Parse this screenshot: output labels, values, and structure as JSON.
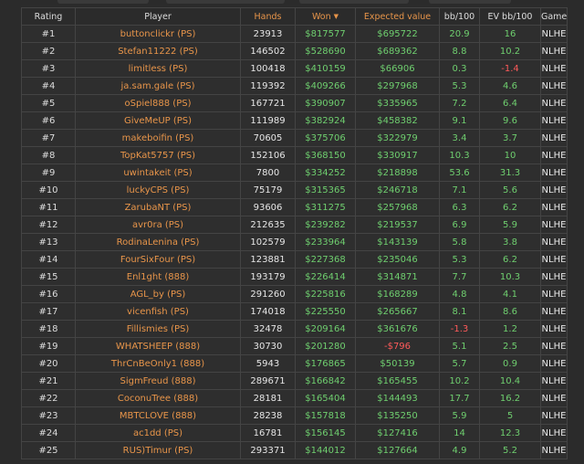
{
  "columns": [
    {
      "key": "rating",
      "label": "Rating"
    },
    {
      "key": "player",
      "label": "Player"
    },
    {
      "key": "hands",
      "label": "Hands"
    },
    {
      "key": "won",
      "label": "Won"
    },
    {
      "key": "ev",
      "label": "Expected value"
    },
    {
      "key": "bb100",
      "label": "bb/100"
    },
    {
      "key": "evbb100",
      "label": "EV bb/100"
    },
    {
      "key": "game",
      "label": "Game"
    }
  ],
  "sort_indicator": "▼",
  "colors": {
    "player": "#e8954a",
    "positive": "#6fcf6f",
    "negative": "#ff5a5a"
  },
  "rows": [
    {
      "rating": "#1",
      "player": "buttonclickr (PS)",
      "hands": "23913",
      "won": "$817577",
      "ev": "$695722",
      "bb100": "20.9",
      "evbb100": "16",
      "game": "NLHE"
    },
    {
      "rating": "#2",
      "player": "Stefan11222 (PS)",
      "hands": "146502",
      "won": "$528690",
      "ev": "$689362",
      "bb100": "8.8",
      "evbb100": "10.2",
      "game": "NLHE"
    },
    {
      "rating": "#3",
      "player": "limitless (PS)",
      "hands": "100418",
      "won": "$410159",
      "ev": "$66906",
      "bb100": "0.3",
      "evbb100": "-1.4",
      "game": "NLHE"
    },
    {
      "rating": "#4",
      "player": "ja.sam.gale (PS)",
      "hands": "119392",
      "won": "$409266",
      "ev": "$297968",
      "bb100": "5.3",
      "evbb100": "4.6",
      "game": "NLHE"
    },
    {
      "rating": "#5",
      "player": "oSpiel888 (PS)",
      "hands": "167721",
      "won": "$390907",
      "ev": "$335965",
      "bb100": "7.2",
      "evbb100": "6.4",
      "game": "NLHE"
    },
    {
      "rating": "#6",
      "player": "GiveMeUP (PS)",
      "hands": "111989",
      "won": "$382924",
      "ev": "$458382",
      "bb100": "9.1",
      "evbb100": "9.6",
      "game": "NLHE"
    },
    {
      "rating": "#7",
      "player": "makeboifin (PS)",
      "hands": "70605",
      "won": "$375706",
      "ev": "$322979",
      "bb100": "3.4",
      "evbb100": "3.7",
      "game": "NLHE"
    },
    {
      "rating": "#8",
      "player": "TopKat5757 (PS)",
      "hands": "152106",
      "won": "$368150",
      "ev": "$330917",
      "bb100": "10.3",
      "evbb100": "10",
      "game": "NLHE"
    },
    {
      "rating": "#9",
      "player": "uwintakeit (PS)",
      "hands": "7800",
      "won": "$334252",
      "ev": "$218898",
      "bb100": "53.6",
      "evbb100": "31.3",
      "game": "NLHE"
    },
    {
      "rating": "#10",
      "player": "luckyCPS (PS)",
      "hands": "75179",
      "won": "$315365",
      "ev": "$246718",
      "bb100": "7.1",
      "evbb100": "5.6",
      "game": "NLHE"
    },
    {
      "rating": "#11",
      "player": "ZarubaNT (PS)",
      "hands": "93606",
      "won": "$311275",
      "ev": "$257968",
      "bb100": "6.3",
      "evbb100": "6.2",
      "game": "NLHE"
    },
    {
      "rating": "#12",
      "player": "avr0ra (PS)",
      "hands": "212635",
      "won": "$239282",
      "ev": "$219537",
      "bb100": "6.9",
      "evbb100": "5.9",
      "game": "NLHE"
    },
    {
      "rating": "#13",
      "player": "RodinaLenina (PS)",
      "hands": "102579",
      "won": "$233964",
      "ev": "$143139",
      "bb100": "5.8",
      "evbb100": "3.8",
      "game": "NLHE"
    },
    {
      "rating": "#14",
      "player": "FourSixFour (PS)",
      "hands": "123881",
      "won": "$227368",
      "ev": "$235046",
      "bb100": "5.3",
      "evbb100": "6.2",
      "game": "NLHE"
    },
    {
      "rating": "#15",
      "player": "Enl1ght (888)",
      "hands": "193179",
      "won": "$226414",
      "ev": "$314871",
      "bb100": "7.7",
      "evbb100": "10.3",
      "game": "NLHE"
    },
    {
      "rating": "#16",
      "player": "AGL_by (PS)",
      "hands": "291260",
      "won": "$225816",
      "ev": "$168289",
      "bb100": "4.8",
      "evbb100": "4.1",
      "game": "NLHE"
    },
    {
      "rating": "#17",
      "player": "vicenfish (PS)",
      "hands": "174018",
      "won": "$225550",
      "ev": "$265667",
      "bb100": "8.1",
      "evbb100": "8.6",
      "game": "NLHE"
    },
    {
      "rating": "#18",
      "player": "Fillismies (PS)",
      "hands": "32478",
      "won": "$209164",
      "ev": "$361676",
      "bb100": "-1.3",
      "evbb100": "1.2",
      "game": "NLHE"
    },
    {
      "rating": "#19",
      "player": "WHATSHEEP (888)",
      "hands": "30730",
      "won": "$201280",
      "ev": "-$796",
      "bb100": "5.1",
      "evbb100": "2.5",
      "game": "NLHE"
    },
    {
      "rating": "#20",
      "player": "ThrCnBeOnly1 (888)",
      "hands": "5943",
      "won": "$176865",
      "ev": "$50139",
      "bb100": "5.7",
      "evbb100": "0.9",
      "game": "NLHE"
    },
    {
      "rating": "#21",
      "player": "SigmFreud (888)",
      "hands": "289671",
      "won": "$166842",
      "ev": "$165455",
      "bb100": "10.2",
      "evbb100": "10.4",
      "game": "NLHE"
    },
    {
      "rating": "#22",
      "player": "CoconuTree (888)",
      "hands": "28181",
      "won": "$165404",
      "ev": "$144493",
      "bb100": "17.7",
      "evbb100": "16.2",
      "game": "NLHE"
    },
    {
      "rating": "#23",
      "player": "MBTCLOVE (888)",
      "hands": "28238",
      "won": "$157818",
      "ev": "$135250",
      "bb100": "5.9",
      "evbb100": "5",
      "game": "NLHE"
    },
    {
      "rating": "#24",
      "player": "ac1dd (PS)",
      "hands": "16781",
      "won": "$156145",
      "ev": "$127416",
      "bb100": "14",
      "evbb100": "12.3",
      "game": "NLHE"
    },
    {
      "rating": "#25",
      "player": "RUS)Timur (PS)",
      "hands": "293371",
      "won": "$144012",
      "ev": "$127664",
      "bb100": "4.9",
      "evbb100": "5.2",
      "game": "NLHE"
    }
  ]
}
